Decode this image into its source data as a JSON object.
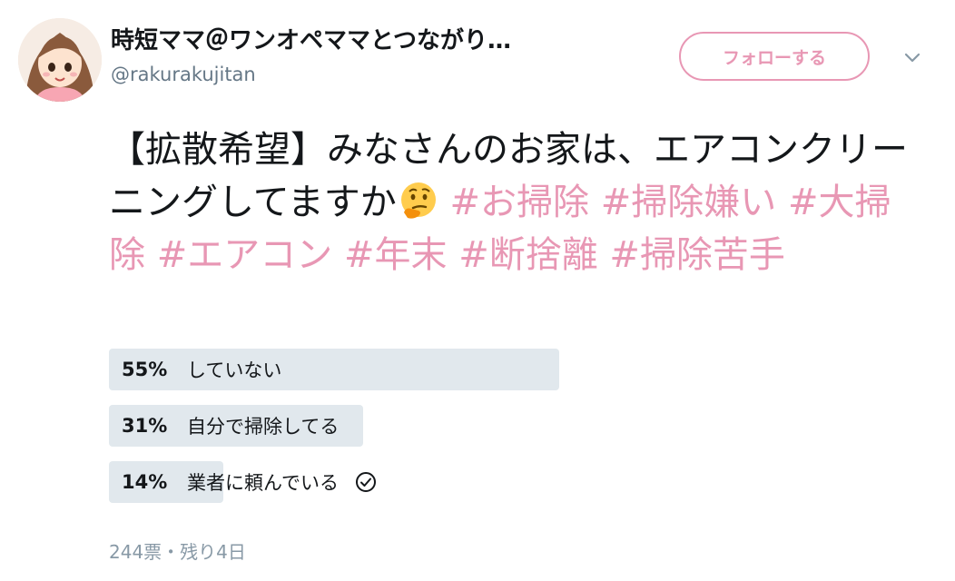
{
  "user": {
    "display_name": "時短ママ＠ワンオペママとつながり…",
    "handle": "@rakurakujitan"
  },
  "follow_label": "フォローする",
  "tweet": {
    "text_plain": "【拡散希望】みなさんのお家は、エアコンクリーニングしてますか",
    "emoji": "thinking-face-icon",
    "hashtags": [
      "#お掃除",
      "#掃除嫌い",
      "#大掃除",
      "#エアコン",
      "#年末",
      "#断捨離",
      "#掃除苦手"
    ]
  },
  "poll": {
    "options": [
      {
        "percent": "55%",
        "label": "していない",
        "value": 55,
        "voted": false
      },
      {
        "percent": "31%",
        "label": "自分で掃除してる",
        "value": 31,
        "voted": false
      },
      {
        "percent": "14%",
        "label": "業者に頼んでいる",
        "value": 14,
        "voted": true
      }
    ],
    "meta": "244票・残り4日"
  },
  "colors": {
    "accent_pink": "#e897b4",
    "bar_gray": "#e1e8ed",
    "text": "#14171a",
    "muted": "#657786"
  }
}
